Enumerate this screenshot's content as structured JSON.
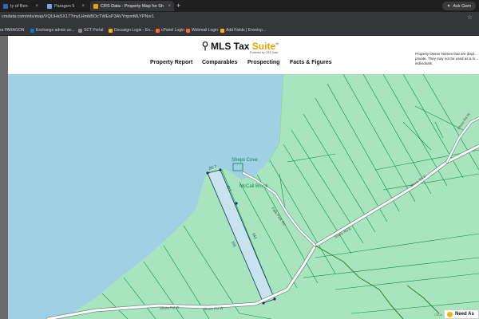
{
  "browser": {
    "tabs": [
      {
        "label": "ty of Ben",
        "active": false,
        "color": "#2b6cb0"
      },
      {
        "label": "Paragon 5",
        "active": false,
        "color": "#6aa8e8"
      },
      {
        "label": "CRS Data - Property Map for Sh",
        "active": true,
        "color": "#e8a200"
      }
    ],
    "new_tab": "+",
    "gemini_label": "Ask Gem",
    "url": "crsdata.com/mls/map/VQUHaSX17?myLHmbBOcTWEsP3AVYnpmMLYPNvr1",
    "bookmarks": [
      {
        "label": "ra PARAGON",
        "color": "#e05a00"
      },
      {
        "label": "Exchange admin ce...",
        "color": "#0078d4"
      },
      {
        "label": "SCT Portal",
        "color": "#8a8a8a"
      },
      {
        "label": "Docusign Login - En...",
        "color": "#f2b705"
      },
      {
        "label": "cPanel Login",
        "color": "#ff6c2c"
      },
      {
        "label": "Webmail Login",
        "color": "#ff6c2c"
      },
      {
        "label": "Add Fields | Envelop...",
        "color": "#f2b705"
      }
    ]
  },
  "header": {
    "logo_main": "MLS Tax",
    "logo_accent": "Suite",
    "logo_tm": "™",
    "logo_sub": "Powered by CRS Data",
    "nav": [
      "Property Report",
      "Comparables",
      "Prospecting",
      "Facts & Figures"
    ],
    "notice": "Property Owner Names that are displ... private. They may not be used as a m... individuals."
  },
  "map": {
    "labels": {
      "cove": "Sheps Cove",
      "brook": "McCall Brook",
      "shore_rd": "Shore Rd W",
      "shore_rd2": "Shore Rd E",
      "park_rd": "Falls Park Rd",
      "n_edge": "Shore Rd W",
      "lot_a": "20-7",
      "lot_b": "1",
      "dim_1": "417",
      "dim_2": "543",
      "dim_3": "166"
    },
    "colors": {
      "water": "#9fd0e4",
      "land": "#a8e5bf",
      "parcel": "#c8e3ee",
      "line": "#0d8a4a",
      "road": "#ffffff",
      "trail": "#2f7d2f"
    }
  },
  "badge": {
    "label": "Need As"
  },
  "attribution": "©2024"
}
